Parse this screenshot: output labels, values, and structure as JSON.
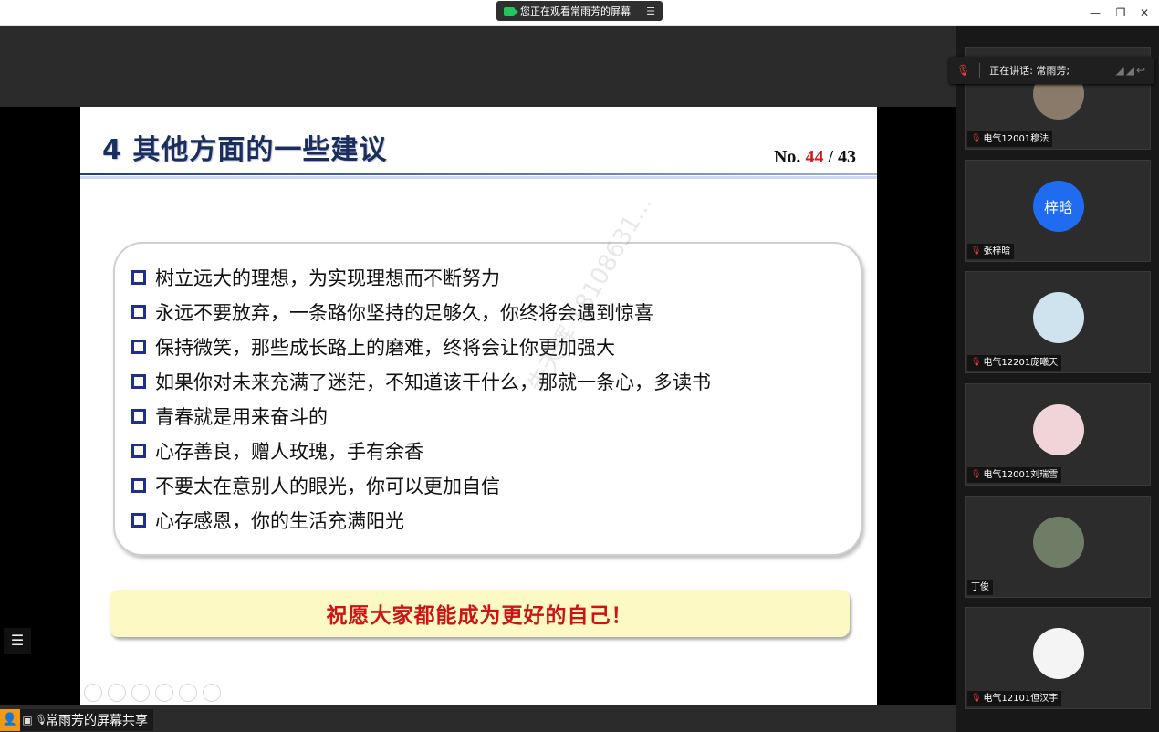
{
  "top_bar": {
    "share_status": "您正在观看常雨芳的屏幕"
  },
  "slide": {
    "title": "4  其他方面的一些建议",
    "page_no_prefix": "No.",
    "page_current": "44",
    "page_separator": "/",
    "page_total": "43",
    "bullets": [
      "树立远大的理想，为实现理想而不断努力",
      "永远不要放弃，一条路你坚持的足够久，你终将会遇到惊喜",
      " 保持微笑，那些成长路上的磨难，终将会让你更加强大",
      " 如果你对未来充满了迷茫，不知道该干什么，那就一条心，多读书",
      " 青春就是用来奋斗的",
      " 心存善良，赠人玫瑰，手有余香",
      " 不要太在意别人的眼光，你可以更加自信",
      " 心存感恩，你的生活充满阳光"
    ],
    "wish": "祝愿大家都能成为更好的自己！",
    "watermark": "朱天辉 18108631..."
  },
  "bottom_bar": {
    "share_label": "常雨芳的屏幕共享"
  },
  "speaking": {
    "label": "正在讲话: 常雨芳;"
  },
  "participants": [
    {
      "name": "电气12001穆法",
      "avatar_text": "",
      "avatar_color": "#8a7a6a"
    },
    {
      "name": "张梓晗",
      "avatar_text": "梓晗",
      "avatar_color": "#1f6cf0"
    },
    {
      "name": "电气12201庞曦天",
      "avatar_text": "",
      "avatar_color": "#cfe3ee"
    },
    {
      "name": "电气12001刘瑞雪",
      "avatar_text": "",
      "avatar_color": "#f1d4d8"
    },
    {
      "name": "丁俊",
      "avatar_text": "",
      "avatar_color": "#6f7d67"
    },
    {
      "name": "电气12101但汉宇",
      "avatar_text": "",
      "avatar_color": "#f4f4f4"
    }
  ],
  "colors": {
    "title": "#1a2d5c",
    "page_current": "#d6191b",
    "wish_text": "#cc1414",
    "wish_bg": "#fdf9c4",
    "bullet_box": "#1f2f8c"
  }
}
